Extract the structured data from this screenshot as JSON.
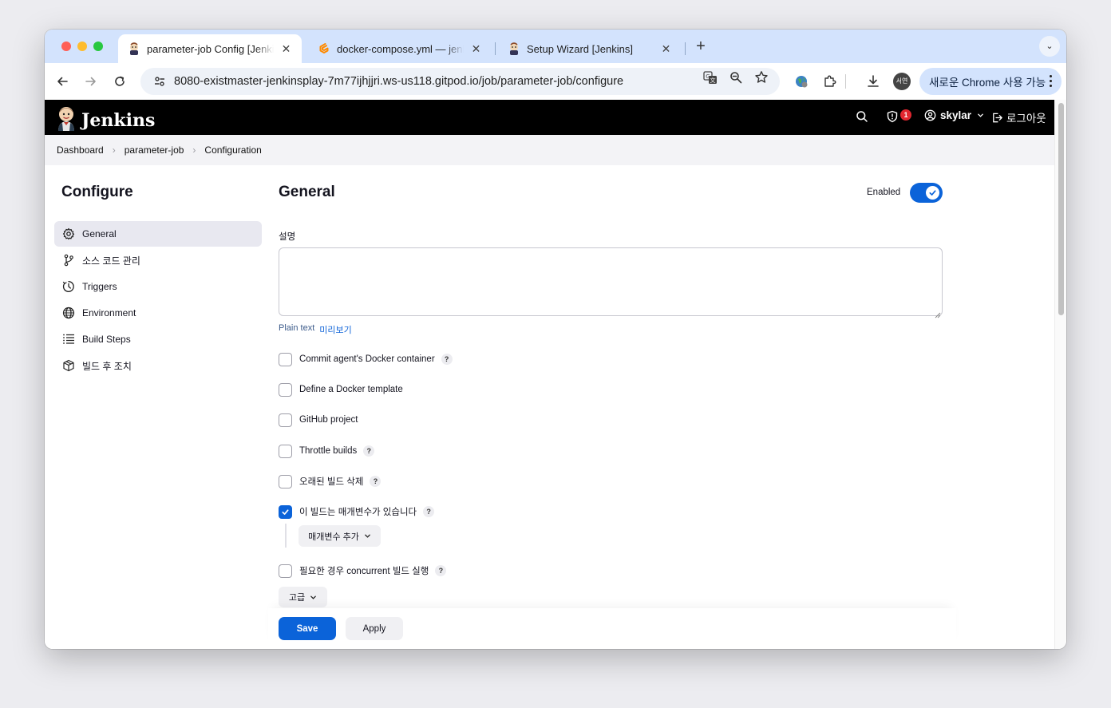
{
  "browser": {
    "tabs": [
      {
        "title": "parameter-job Config [Jenkins]",
        "icon": "jenkins-butler-icon",
        "active": true
      },
      {
        "title": "docker-compose.yml — jenkins",
        "icon": "gitpod-icon",
        "active": false
      },
      {
        "title": "Setup Wizard [Jenkins]",
        "icon": "jenkins-butler-icon",
        "active": false
      }
    ],
    "close_glyph": "✕",
    "new_tab_glyph": "+",
    "tab_menu_glyph": "⌄",
    "url": "8080-existmaster-jenkinsplay-7m77ijhjjri.ws-us118.gitpod.io/job/parameter-job/configure",
    "profile_initials": "서연",
    "update_button": "새로운 Chrome 사용 가능"
  },
  "header": {
    "brand": "Jenkins",
    "security_badge_count": "1",
    "user": "skylar",
    "logout": "로그아웃"
  },
  "breadcrumb": {
    "items": [
      "Dashboard",
      "parameter-job",
      "Configuration"
    ]
  },
  "sidebar": {
    "title": "Configure",
    "items": [
      {
        "label": "General",
        "icon": "gear-icon",
        "active": true
      },
      {
        "label": "소스 코드 관리",
        "icon": "git-branch-icon"
      },
      {
        "label": "Triggers",
        "icon": "clock-icon"
      },
      {
        "label": "Environment",
        "icon": "globe-icon"
      },
      {
        "label": "Build Steps",
        "icon": "list-icon"
      },
      {
        "label": "빌드 후 조치",
        "icon": "package-icon"
      }
    ]
  },
  "main": {
    "title": "General",
    "enabled_label": "Enabled",
    "enabled": true,
    "description_label": "설명",
    "description_value": "",
    "plain_text": "Plain text",
    "preview": "미리보기",
    "help_glyph": "?",
    "options": [
      {
        "label": "Commit agent's Docker container",
        "checked": false,
        "help": true
      },
      {
        "label": "Define a Docker template",
        "checked": false,
        "help": false
      },
      {
        "label": "GitHub project",
        "checked": false,
        "help": false
      },
      {
        "label": "Throttle builds",
        "checked": false,
        "help": true
      },
      {
        "label": "오래된 빌드 삭제",
        "checked": false,
        "help": true
      },
      {
        "label": "이 빌드는 매개변수가 있습니다",
        "checked": true,
        "help": true
      },
      {
        "label": "필요한 경우 concurrent 빌드 실행",
        "checked": false,
        "help": true
      }
    ],
    "add_parameter": "매개변수 추가",
    "advanced": "고급",
    "save": "Save",
    "apply": "Apply"
  },
  "colors": {
    "accent": "#0b63d9",
    "header_bg": "#000000",
    "tab_strip": "#d3e3fd",
    "badge": "#e0262f"
  }
}
